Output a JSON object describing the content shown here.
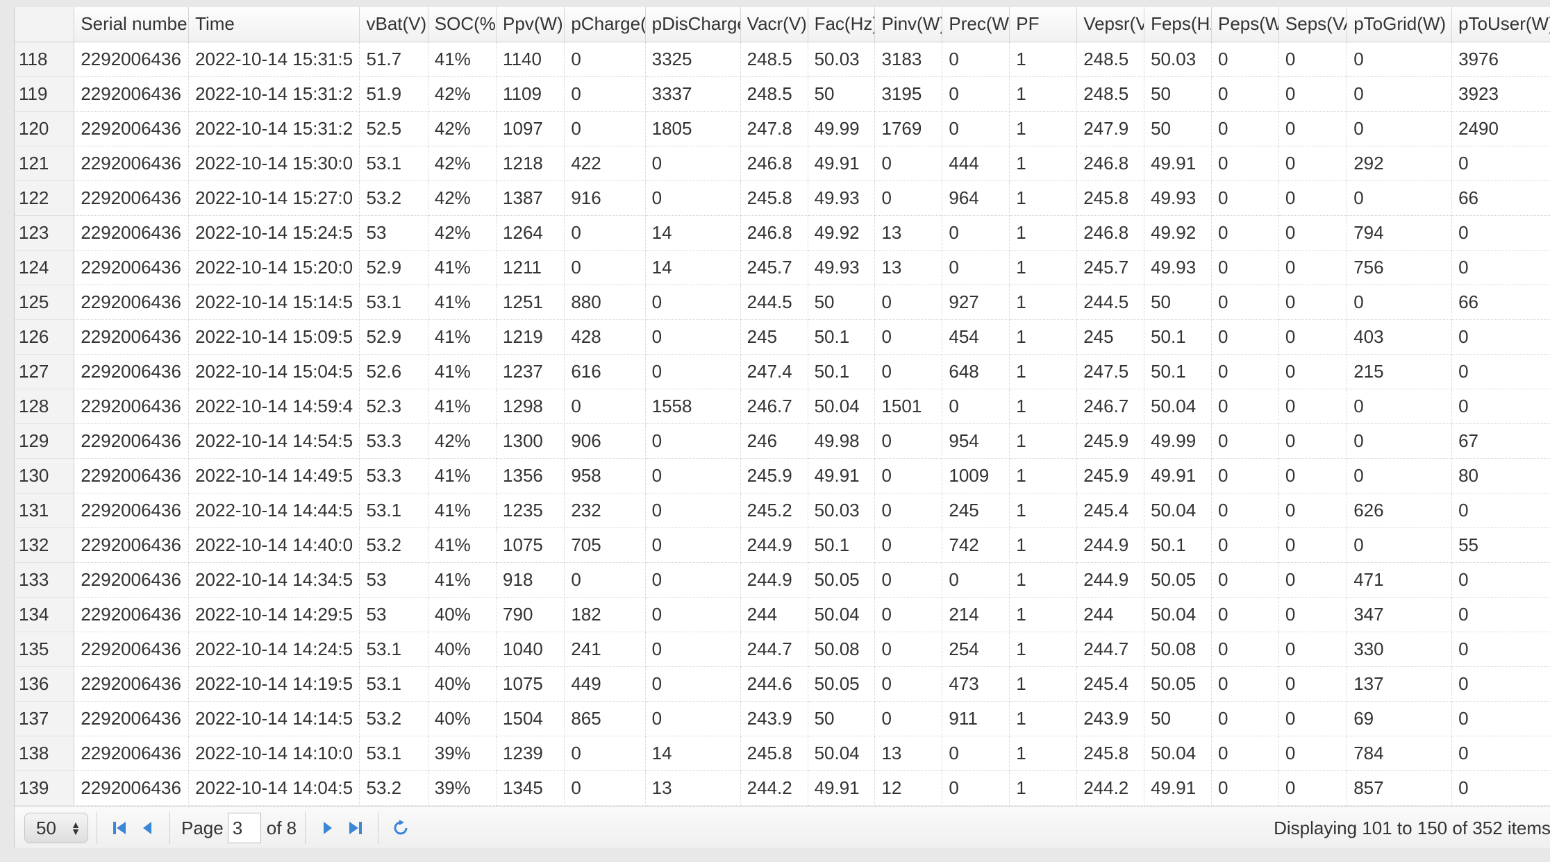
{
  "columns": [
    "",
    "Serial number",
    "Time",
    "vBat(V)",
    "SOC(%)",
    "Ppv(W)",
    "pCharge(W)",
    "pDisCharge(W)",
    "Vacr(V)",
    "Fac(Hz)",
    "Pinv(W)",
    "Prec(W)",
    "PF",
    "Vepsr(V)",
    "Feps(Hz)",
    "Peps(W)",
    "Seps(VA)",
    "pToGrid(W)",
    "pToUser(W)"
  ],
  "rows": [
    [
      "118",
      "2292006436",
      "2022-10-14 15:31:5",
      "51.7",
      "41%",
      "1140",
      "0",
      "3325",
      "248.5",
      "50.03",
      "3183",
      "0",
      "1",
      "248.5",
      "50.03",
      "0",
      "0",
      "0",
      "3976"
    ],
    [
      "119",
      "2292006436",
      "2022-10-14 15:31:2",
      "51.9",
      "42%",
      "1109",
      "0",
      "3337",
      "248.5",
      "50",
      "3195",
      "0",
      "1",
      "248.5",
      "50",
      "0",
      "0",
      "0",
      "3923"
    ],
    [
      "120",
      "2292006436",
      "2022-10-14 15:31:2",
      "52.5",
      "42%",
      "1097",
      "0",
      "1805",
      "247.8",
      "49.99",
      "1769",
      "0",
      "1",
      "247.9",
      "50",
      "0",
      "0",
      "0",
      "2490"
    ],
    [
      "121",
      "2292006436",
      "2022-10-14 15:30:0",
      "53.1",
      "42%",
      "1218",
      "422",
      "0",
      "246.8",
      "49.91",
      "0",
      "444",
      "1",
      "246.8",
      "49.91",
      "0",
      "0",
      "292",
      "0"
    ],
    [
      "122",
      "2292006436",
      "2022-10-14 15:27:0",
      "53.2",
      "42%",
      "1387",
      "916",
      "0",
      "245.8",
      "49.93",
      "0",
      "964",
      "1",
      "245.8",
      "49.93",
      "0",
      "0",
      "0",
      "66"
    ],
    [
      "123",
      "2292006436",
      "2022-10-14 15:24:5",
      "53",
      "42%",
      "1264",
      "0",
      "14",
      "246.8",
      "49.92",
      "13",
      "0",
      "1",
      "246.8",
      "49.92",
      "0",
      "0",
      "794",
      "0"
    ],
    [
      "124",
      "2292006436",
      "2022-10-14 15:20:0",
      "52.9",
      "41%",
      "1211",
      "0",
      "14",
      "245.7",
      "49.93",
      "13",
      "0",
      "1",
      "245.7",
      "49.93",
      "0",
      "0",
      "756",
      "0"
    ],
    [
      "125",
      "2292006436",
      "2022-10-14 15:14:5",
      "53.1",
      "41%",
      "1251",
      "880",
      "0",
      "244.5",
      "50",
      "0",
      "927",
      "1",
      "244.5",
      "50",
      "0",
      "0",
      "0",
      "66"
    ],
    [
      "126",
      "2292006436",
      "2022-10-14 15:09:5",
      "52.9",
      "41%",
      "1219",
      "428",
      "0",
      "245",
      "50.1",
      "0",
      "454",
      "1",
      "245",
      "50.1",
      "0",
      "0",
      "403",
      "0"
    ],
    [
      "127",
      "2292006436",
      "2022-10-14 15:04:5",
      "52.6",
      "41%",
      "1237",
      "616",
      "0",
      "247.4",
      "50.1",
      "0",
      "648",
      "1",
      "247.5",
      "50.1",
      "0",
      "0",
      "215",
      "0"
    ],
    [
      "128",
      "2292006436",
      "2022-10-14 14:59:4",
      "52.3",
      "41%",
      "1298",
      "0",
      "1558",
      "246.7",
      "50.04",
      "1501",
      "0",
      "1",
      "246.7",
      "50.04",
      "0",
      "0",
      "0",
      "0"
    ],
    [
      "129",
      "2292006436",
      "2022-10-14 14:54:5",
      "53.3",
      "42%",
      "1300",
      "906",
      "0",
      "246",
      "49.98",
      "0",
      "954",
      "1",
      "245.9",
      "49.99",
      "0",
      "0",
      "0",
      "67"
    ],
    [
      "130",
      "2292006436",
      "2022-10-14 14:49:5",
      "53.3",
      "41%",
      "1356",
      "958",
      "0",
      "245.9",
      "49.91",
      "0",
      "1009",
      "1",
      "245.9",
      "49.91",
      "0",
      "0",
      "0",
      "80"
    ],
    [
      "131",
      "2292006436",
      "2022-10-14 14:44:5",
      "53.1",
      "41%",
      "1235",
      "232",
      "0",
      "245.2",
      "50.03",
      "0",
      "245",
      "1",
      "245.4",
      "50.04",
      "0",
      "0",
      "626",
      "0"
    ],
    [
      "132",
      "2292006436",
      "2022-10-14 14:40:0",
      "53.2",
      "41%",
      "1075",
      "705",
      "0",
      "244.9",
      "50.1",
      "0",
      "742",
      "1",
      "244.9",
      "50.1",
      "0",
      "0",
      "0",
      "55"
    ],
    [
      "133",
      "2292006436",
      "2022-10-14 14:34:5",
      "53",
      "41%",
      "918",
      "0",
      "0",
      "244.9",
      "50.05",
      "0",
      "0",
      "1",
      "244.9",
      "50.05",
      "0",
      "0",
      "471",
      "0"
    ],
    [
      "134",
      "2292006436",
      "2022-10-14 14:29:5",
      "53",
      "40%",
      "790",
      "182",
      "0",
      "244",
      "50.04",
      "0",
      "214",
      "1",
      "244",
      "50.04",
      "0",
      "0",
      "347",
      "0"
    ],
    [
      "135",
      "2292006436",
      "2022-10-14 14:24:5",
      "53.1",
      "40%",
      "1040",
      "241",
      "0",
      "244.7",
      "50.08",
      "0",
      "254",
      "1",
      "244.7",
      "50.08",
      "0",
      "0",
      "330",
      "0"
    ],
    [
      "136",
      "2292006436",
      "2022-10-14 14:19:5",
      "53.1",
      "40%",
      "1075",
      "449",
      "0",
      "244.6",
      "50.05",
      "0",
      "473",
      "1",
      "245.4",
      "50.05",
      "0",
      "0",
      "137",
      "0"
    ],
    [
      "137",
      "2292006436",
      "2022-10-14 14:14:5",
      "53.2",
      "40%",
      "1504",
      "865",
      "0",
      "243.9",
      "50",
      "0",
      "911",
      "1",
      "243.9",
      "50",
      "0",
      "0",
      "69",
      "0"
    ],
    [
      "138",
      "2292006436",
      "2022-10-14 14:10:0",
      "53.1",
      "39%",
      "1239",
      "0",
      "14",
      "245.8",
      "50.04",
      "13",
      "0",
      "1",
      "245.8",
      "50.04",
      "0",
      "0",
      "784",
      "0"
    ],
    [
      "139",
      "2292006436",
      "2022-10-14 14:04:5",
      "53.2",
      "39%",
      "1345",
      "0",
      "13",
      "244.2",
      "49.91",
      "12",
      "0",
      "1",
      "244.2",
      "49.91",
      "0",
      "0",
      "857",
      "0"
    ]
  ],
  "pager": {
    "page_size": "50",
    "page_label": "Page",
    "current_page": "3",
    "of_label": "of 8",
    "display_message": "Displaying 101 to 150 of 352 items"
  },
  "colors": {
    "nav_icon": "#3a87d8",
    "header_bg": "#f5f5f5",
    "rownum_bg": "#f3f3f3",
    "panel_bg": "#e8e8e8"
  },
  "icons": {
    "first_page": "first-page-icon",
    "prev_page": "prev-page-icon",
    "next_page": "next-page-icon",
    "last_page": "last-page-icon",
    "refresh": "refresh-icon",
    "page_size_arrows": "up-down-arrows-icon"
  }
}
